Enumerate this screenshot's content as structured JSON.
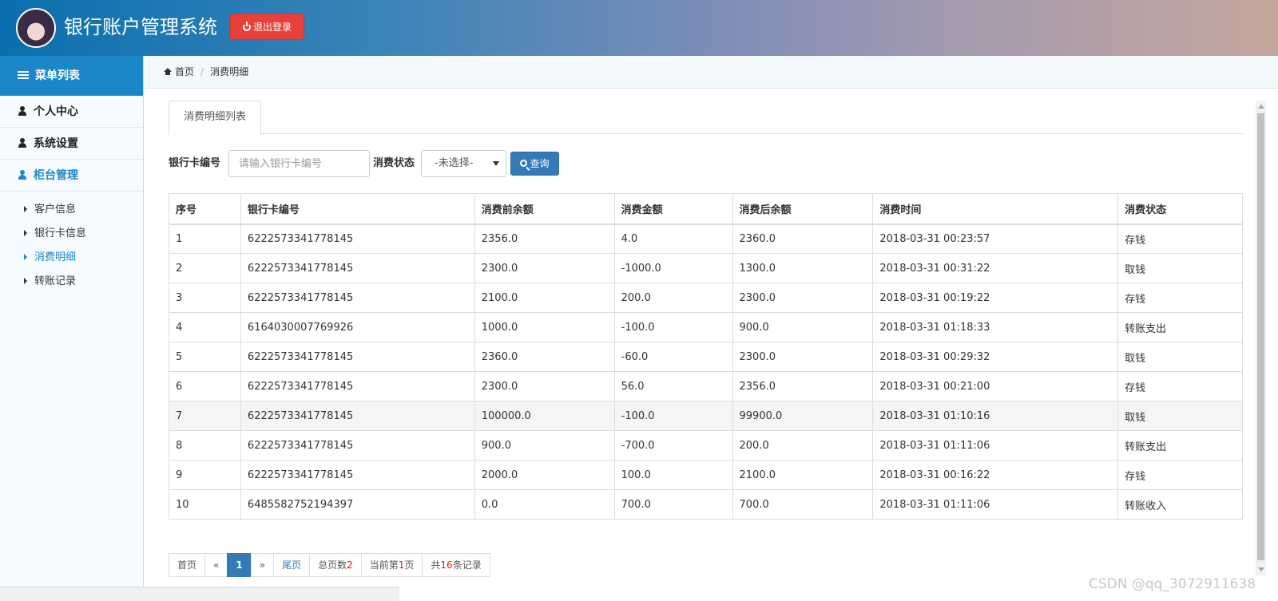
{
  "header": {
    "title": "银行账户管理系统",
    "logout_label": "退出登录"
  },
  "sidebar": {
    "menu_title": "菜单列表",
    "groups": [
      {
        "label": "个人中心"
      },
      {
        "label": "系统设置"
      },
      {
        "label": "柜台管理"
      }
    ],
    "sub_items": [
      {
        "label": "客户信息"
      },
      {
        "label": "银行卡信息"
      },
      {
        "label": "消费明细"
      },
      {
        "label": "转账记录"
      }
    ]
  },
  "breadcrumb": {
    "home": "首页",
    "current": "消费明细"
  },
  "main": {
    "tab_label": "消费明细列表",
    "search": {
      "card_label": "银行卡编号",
      "card_placeholder": "请输入银行卡编号",
      "status_label": "消费状态",
      "status_selected": "-未选择-",
      "query_label": "查询"
    },
    "table": {
      "headers": [
        "序号",
        "银行卡编号",
        "消费前余额",
        "消费金额",
        "消费后余额",
        "消费时间",
        "消费状态"
      ],
      "rows": [
        [
          "1",
          "6222573341778145",
          "2356.0",
          "4.0",
          "2360.0",
          "2018-03-31 00:23:57",
          "存钱"
        ],
        [
          "2",
          "6222573341778145",
          "2300.0",
          "-1000.0",
          "1300.0",
          "2018-03-31 00:31:22",
          "取钱"
        ],
        [
          "3",
          "6222573341778145",
          "2100.0",
          "200.0",
          "2300.0",
          "2018-03-31 00:19:22",
          "存钱"
        ],
        [
          "4",
          "6164030007769926",
          "1000.0",
          "-100.0",
          "900.0",
          "2018-03-31 01:18:33",
          "转账支出"
        ],
        [
          "5",
          "6222573341778145",
          "2360.0",
          "-60.0",
          "2300.0",
          "2018-03-31 00:29:32",
          "取钱"
        ],
        [
          "6",
          "6222573341778145",
          "2300.0",
          "56.0",
          "2356.0",
          "2018-03-31 00:21:00",
          "存钱"
        ],
        [
          "7",
          "6222573341778145",
          "100000.0",
          "-100.0",
          "99900.0",
          "2018-03-31 01:10:16",
          "取钱"
        ],
        [
          "8",
          "6222573341778145",
          "900.0",
          "-700.0",
          "200.0",
          "2018-03-31 01:11:06",
          "转账支出"
        ],
        [
          "9",
          "6222573341778145",
          "2000.0",
          "100.0",
          "2100.0",
          "2018-03-31 00:16:22",
          "存钱"
        ],
        [
          "10",
          "6485582752194397",
          "0.0",
          "700.0",
          "700.0",
          "2018-03-31 01:11:06",
          "转账收入"
        ]
      ]
    },
    "pager": {
      "first": "首页",
      "prev": "«",
      "current_page": "1",
      "next": "»",
      "last": "尾页",
      "total_pages_label": "总页数",
      "total_pages": "2",
      "current_prefix": "当前第",
      "current_value": "1",
      "current_suffix": "页",
      "records_prefix": "共",
      "records_value": "16",
      "records_suffix": "条记录"
    }
  },
  "watermark": "CSDN @qq_3072911638",
  "colors": {
    "accent": "#1b87c9",
    "logout": "#e8413c",
    "primary_button": "#337ab7",
    "highlight_number": "#d9251c"
  }
}
